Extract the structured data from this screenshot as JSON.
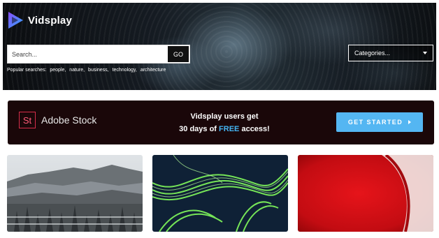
{
  "header": {
    "brand": "Vidsplay",
    "search": {
      "placeholder": "Search...",
      "button_label": "GO"
    },
    "popular": {
      "label": "Popular searches:",
      "items": [
        "people,",
        "nature,",
        "business,",
        "technology,",
        "architecture"
      ]
    },
    "categories": {
      "selected": "Categories..."
    }
  },
  "banner": {
    "logo_mark": "St",
    "brand": "Adobe Stock",
    "line1": "Vidsplay users get",
    "line2_before": "30 days of",
    "line2_highlight": "FREE",
    "line2_after": "access!",
    "cta_label": "GET STARTED",
    "highlight_color": "#44b4f2",
    "cta_color": "#54b6f2"
  },
  "thumbnails": [
    {
      "icon": "snowy-forest-thumbnail"
    },
    {
      "icon": "green-fibers-thumbnail"
    },
    {
      "icon": "red-abstract-thumbnail"
    }
  ],
  "colors": {
    "logo_gradient": [
      "#8a4dff",
      "#2ea8ff"
    ]
  }
}
